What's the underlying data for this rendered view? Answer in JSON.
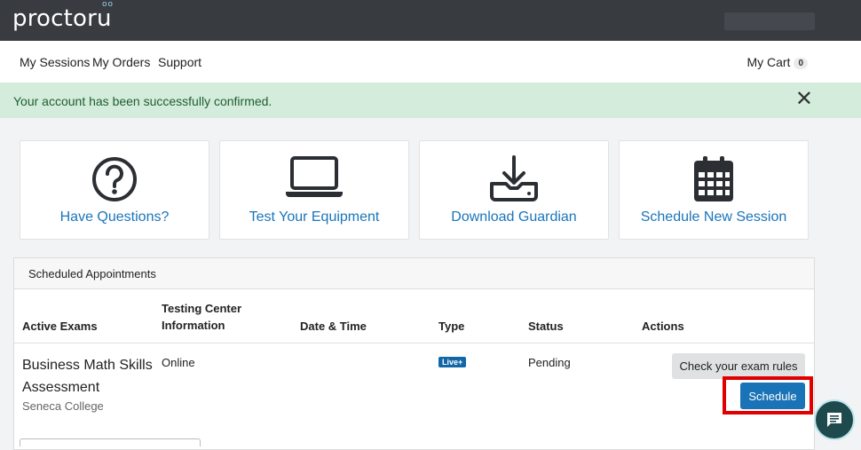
{
  "brand": {
    "logo_text": "proctor",
    "logo_u": "u"
  },
  "nav": {
    "items": [
      "My Sessions",
      "My Orders",
      "Support"
    ],
    "cart_label": "My Cart",
    "cart_count": "0"
  },
  "alert": {
    "message": "Your account has been successfully confirmed.",
    "close_glyph": "✕"
  },
  "cards": [
    {
      "label": "Have Questions?",
      "icon": "question-circle-icon"
    },
    {
      "label": "Test Your Equipment",
      "icon": "laptop-icon"
    },
    {
      "label": "Download Guardian",
      "icon": "download-icon"
    },
    {
      "label": "Schedule New Session",
      "icon": "calendar-icon"
    }
  ],
  "appointments": {
    "title": "Scheduled Appointments",
    "columns": [
      "Active Exams",
      "Testing Center Information",
      "Date & Time",
      "Type",
      "Status",
      "Actions"
    ],
    "rows": [
      {
        "exam": "Business Math Skills Assessment",
        "institution": "Seneca College",
        "testing_center": "Online",
        "date_time": "",
        "type": "Live+",
        "status": "Pending",
        "actions": [
          "Check your exam rules",
          "Schedule"
        ]
      }
    ]
  },
  "colors": {
    "accent": "#1a75bb",
    "highlight": "#e00000",
    "alert_bg": "#d4ecdb"
  }
}
